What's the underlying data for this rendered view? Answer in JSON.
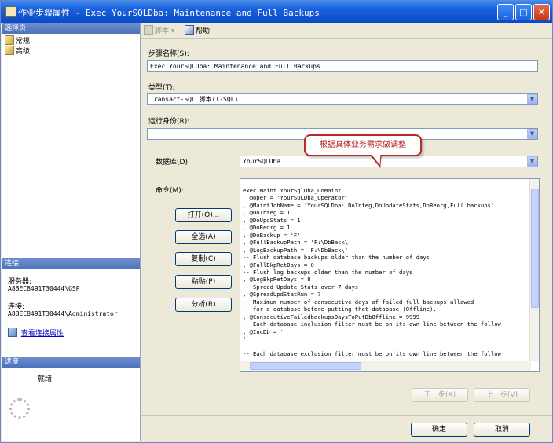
{
  "window": {
    "title": "作业步骤属性 - Exec YourSQLDba: Maintenance and Full Backups",
    "minimize_glyph": "_",
    "maximize_glyph": "□",
    "close_glyph": "✕"
  },
  "left_pane": {
    "select_page_header": "选择页",
    "pages": [
      {
        "label": "常规",
        "icon": "page-icon"
      },
      {
        "label": "高级",
        "icon": "page-icon"
      }
    ],
    "connection_header": "连接",
    "server_label": "服务器:",
    "server_value": "A8BEC8491T30444\\GSP",
    "connection_label": "连接:",
    "connection_value": "A8BEC8491T30444\\Administrator",
    "view_connection_link": "查看连接属性",
    "progress_header": "进度",
    "progress_status": "就绪"
  },
  "toolbar": {
    "script_label": "脚本",
    "help_label": "帮助"
  },
  "form": {
    "step_name_label": "步骤名称(S):",
    "step_name_value": "Exec YourSQLDba: Maintenance and Full Backups",
    "type_label": "类型(T):",
    "type_value": "Transact-SQL 脚本(T-SQL)",
    "run_as_label": "运行身份(R):",
    "run_as_value": "",
    "database_label": "数据库(D):",
    "database_value": "YourSQLDba",
    "command_label": "命令(M):",
    "callout_text": "根据具体业务需求做调整",
    "command_lines": [
      "exec Maint.YourSqlDba_DoMaint",
      "  @oper = 'YourSQLDba_Operator'",
      ", @MaintJobName = 'YourSQLDba: DoInteg,DoUpdateStats,DoReorg,Full backups'",
      ", @DoInteg = 1",
      ", @DoUpdStats = 1",
      ", @DoReorg = 1",
      ", @DoBackup = 'F'",
      ", @FullBackupPath = 'F:\\DbBack\\'",
      ", @LogBackupPath = 'F:\\DbBack\\'",
      "-- Flush database backups older than the number of days",
      ", @FullBkpRetDays = 0",
      "-- Flush log backups older than the number of days",
      ", @LogBkpRetDays = 8",
      "-- Spread Update Stats over 7 days",
      ", @SpreadUpdStatRun = 7",
      "-- Maximum number of consecutive days of failed full backups allowed",
      "-- for a database before putting that database (Offline).",
      ", @ConsecutiveFailedbackupsDaysToPutDbOffline = 9999",
      "-- Each database inclusion filter must be on its own line between the follow",
      ", @IncDb = '",
      "'",
      "",
      "-- Each database exclusion filter must be on its own line between the follow"
    ]
  },
  "buttons": {
    "open": "打开(O)...",
    "select_all": "全选(A)",
    "copy": "复制(C)",
    "paste": "粘贴(P)",
    "parse": "分析(R)",
    "next": "下一步(X)",
    "previous": "上一步(V)",
    "ok": "确定",
    "cancel": "取消"
  }
}
